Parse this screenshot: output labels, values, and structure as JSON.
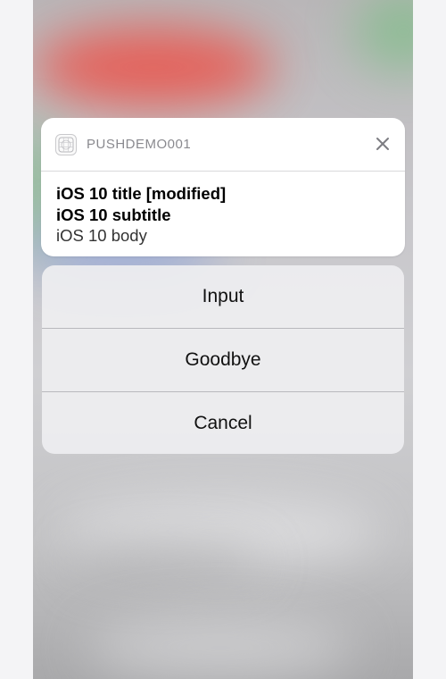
{
  "notification": {
    "app_name": "PUSHDEMO001",
    "app_icon": "app-grid-icon",
    "close_icon": "close-icon",
    "title": "iOS 10 title [modified]",
    "subtitle": "iOS 10 subtitle",
    "body": "iOS 10 body"
  },
  "actions": [
    {
      "label": "Input"
    },
    {
      "label": "Goodbye"
    },
    {
      "label": "Cancel"
    }
  ],
  "colors": {
    "card_background": "#ffffff",
    "action_sheet_background": "#eeeef0",
    "divider": "#b9b9bd",
    "secondary_text": "#8a8a8f"
  }
}
